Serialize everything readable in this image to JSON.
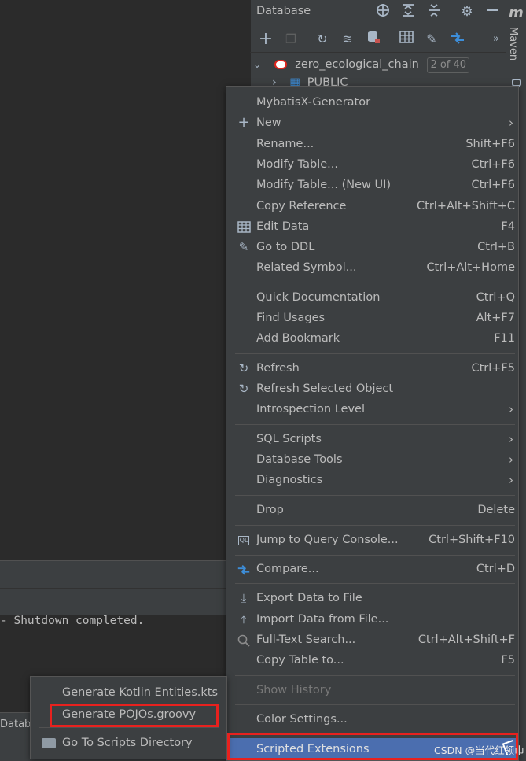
{
  "database_panel": {
    "title": "Database",
    "header_icons": [
      "crosshair-icon",
      "expand-all-icon",
      "collapse-all-icon",
      "settings-icon",
      "minimize-icon"
    ],
    "toolbar_icons": [
      "add-icon",
      "duplicate-icon",
      "refresh-icon",
      "schema-sync-icon",
      "data-source-properties-icon",
      "table-icon",
      "edit-icon",
      "compare-icon",
      "more-icon"
    ],
    "tree": {
      "connection_name": "zero_ecological_chain",
      "connection_badge": "2 of 40",
      "child_name": "PUBLIC"
    }
  },
  "right_stripe": {
    "maven_icon_text": "m",
    "maven_label": "Maven"
  },
  "console": {
    "output_line": "- Shutdown completed."
  },
  "status_bar": {
    "database_tab_label": "Databa"
  },
  "context_menu": {
    "items": [
      {
        "label": "MybatisX-Generator",
        "shortcut": "",
        "icon": "",
        "submenu": false
      },
      {
        "label": "New",
        "shortcut": "",
        "icon": "plus-icon",
        "submenu": true
      },
      {
        "label": "Rename...",
        "shortcut": "Shift+F6",
        "icon": "",
        "submenu": false
      },
      {
        "label": "Modify Table...",
        "shortcut": "Ctrl+F6",
        "icon": "",
        "submenu": false
      },
      {
        "label": "Modify Table... (New UI)",
        "shortcut": "Ctrl+F6",
        "icon": "",
        "submenu": false
      },
      {
        "label": "Copy Reference",
        "shortcut": "Ctrl+Alt+Shift+C",
        "icon": "",
        "submenu": false
      },
      {
        "label": "Edit Data",
        "shortcut": "F4",
        "icon": "table-grid-icon",
        "submenu": false
      },
      {
        "label": "Go to DDL",
        "shortcut": "Ctrl+B",
        "icon": "pencil-icon",
        "submenu": false
      },
      {
        "label": "Related Symbol...",
        "shortcut": "Ctrl+Alt+Home",
        "icon": "",
        "submenu": false
      },
      {
        "label": "Quick Documentation",
        "shortcut": "Ctrl+Q",
        "icon": "",
        "submenu": false
      },
      {
        "label": "Find Usages",
        "shortcut": "Alt+F7",
        "icon": "",
        "submenu": false
      },
      {
        "label": "Add Bookmark",
        "shortcut": "F11",
        "icon": "",
        "submenu": false
      },
      {
        "label": "Refresh",
        "shortcut": "Ctrl+F5",
        "icon": "refresh-icon",
        "submenu": false
      },
      {
        "label": "Refresh Selected Object",
        "shortcut": "",
        "icon": "refresh-icon",
        "submenu": false
      },
      {
        "label": "Introspection Level",
        "shortcut": "",
        "icon": "",
        "submenu": true
      },
      {
        "label": "SQL Scripts",
        "shortcut": "",
        "icon": "",
        "submenu": true
      },
      {
        "label": "Database Tools",
        "shortcut": "",
        "icon": "",
        "submenu": true
      },
      {
        "label": "Diagnostics",
        "shortcut": "",
        "icon": "",
        "submenu": true
      },
      {
        "label": "Drop",
        "shortcut": "Delete",
        "icon": "",
        "submenu": false
      },
      {
        "label": "Jump to Query Console...",
        "shortcut": "Ctrl+Shift+F10",
        "icon": "query-console-icon",
        "submenu": false
      },
      {
        "label": "Compare...",
        "shortcut": "Ctrl+D",
        "icon": "compare-icon",
        "submenu": false
      },
      {
        "label": "Export Data to File",
        "shortcut": "",
        "icon": "export-icon",
        "submenu": false
      },
      {
        "label": "Import Data from File...",
        "shortcut": "",
        "icon": "import-icon",
        "submenu": false
      },
      {
        "label": "Full-Text Search...",
        "shortcut": "Ctrl+Alt+Shift+F",
        "icon": "search-icon",
        "submenu": false
      },
      {
        "label": "Copy Table to...",
        "shortcut": "F5",
        "icon": "",
        "submenu": false
      },
      {
        "label": "Show History",
        "shortcut": "",
        "icon": "",
        "submenu": false,
        "disabled": true
      },
      {
        "label": "Color Settings...",
        "shortcut": "",
        "icon": "",
        "submenu": false
      },
      {
        "label": "Scripted Extensions",
        "shortcut": "",
        "icon": "",
        "submenu": true,
        "selected": true
      }
    ]
  },
  "sub_menu": {
    "items": [
      {
        "label": "Generate Kotlin Entities.kts"
      },
      {
        "label": "Generate POJOs.groovy"
      },
      {
        "label": "Go To Scripts Directory",
        "icon": "folder-icon"
      }
    ]
  },
  "watermark": "CSDN @当代红领巾",
  "colors": {
    "selection": "#4b6eaf",
    "highlight_box": "#e8211e",
    "menu_background": "#3c3f41"
  }
}
